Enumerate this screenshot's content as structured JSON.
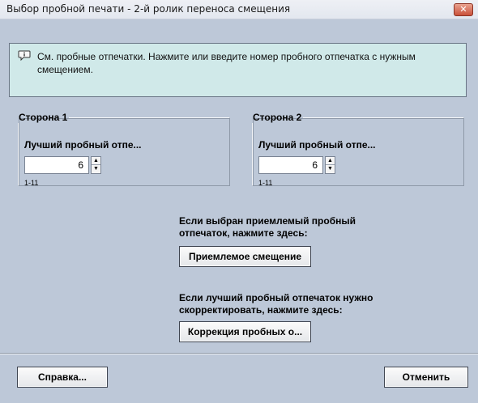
{
  "dialog": {
    "title": "Выбор пробной печати - 2-й ролик переноса смещения",
    "close_label": "✕"
  },
  "info": {
    "icon": "speech-bubble-icon",
    "text": "См. пробные отпечатки.  Нажмите или введите номер пробного отпечатка с нужным смещением."
  },
  "side1": {
    "legend": "Сторона 1",
    "label": "Лучший пробный отпе...",
    "value": "6",
    "range": "1-11"
  },
  "side2": {
    "legend": "Сторона 2",
    "label": "Лучший пробный отпе...",
    "value": "6",
    "range": "1-11"
  },
  "accept": {
    "prompt": "Если выбран приемлемый пробный отпечаток, нажмите здесь:",
    "button_label": "Приемлемое смещение"
  },
  "correct": {
    "prompt": "Если лучший пробный отпечаток нужно скорректировать, нажмите здесь:",
    "button_label": "Коррекция пробных о..."
  },
  "footer": {
    "help_label": "Справка...",
    "cancel_label": "Отменить"
  },
  "colors": {
    "background": "#bdc8d8",
    "info_background": "#d0e9e9",
    "close_button": "#c9503a"
  }
}
